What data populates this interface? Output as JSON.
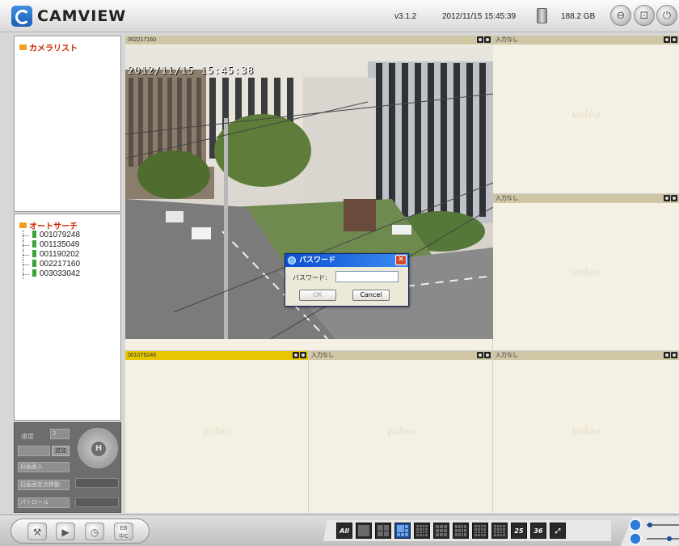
{
  "app": {
    "title": "CAMVIEW",
    "version": "v3.1.2",
    "datetime": "2012/11/15 15:45:39",
    "storage": "188.2 GB"
  },
  "sidebar": {
    "camera_list_title": "カメラリスト",
    "autosearch_title": "オートサーチ",
    "cameras": [
      "001079248",
      "001135049",
      "001190202",
      "002217160",
      "003033042"
    ]
  },
  "controls": {
    "speed_label": "速度",
    "speed_value": "2",
    "add_button": "追加",
    "timing_select": "旧画面入",
    "preset_select": "旧画面定点移動",
    "patrol_label": "パトロール"
  },
  "cells": [
    {
      "id": "002217160",
      "osd": "2012/11/15 15:45:38"
    },
    {
      "id": "入力なし",
      "watermark": "video"
    },
    {
      "id": "入力なし",
      "watermark": "video"
    },
    {
      "id": "001079248",
      "watermark": "video"
    },
    {
      "id": "入力なし",
      "watermark": "video"
    },
    {
      "id": "入力なし",
      "watermark": "video"
    }
  ],
  "dialog": {
    "title": "パスワード",
    "label": "パスワード:",
    "ok": "OK",
    "cancel": "Cancel",
    "close": "✕"
  },
  "bottom": {
    "lang_label_1": "EB",
    "lang_label_2": "中C",
    "layout_all": "All",
    "layout_25": "25",
    "layout_36": "36"
  },
  "colors": {
    "selected_header": "#e7c800",
    "dialog_title": "#0a4fd0",
    "accent_red": "#cc2200"
  }
}
